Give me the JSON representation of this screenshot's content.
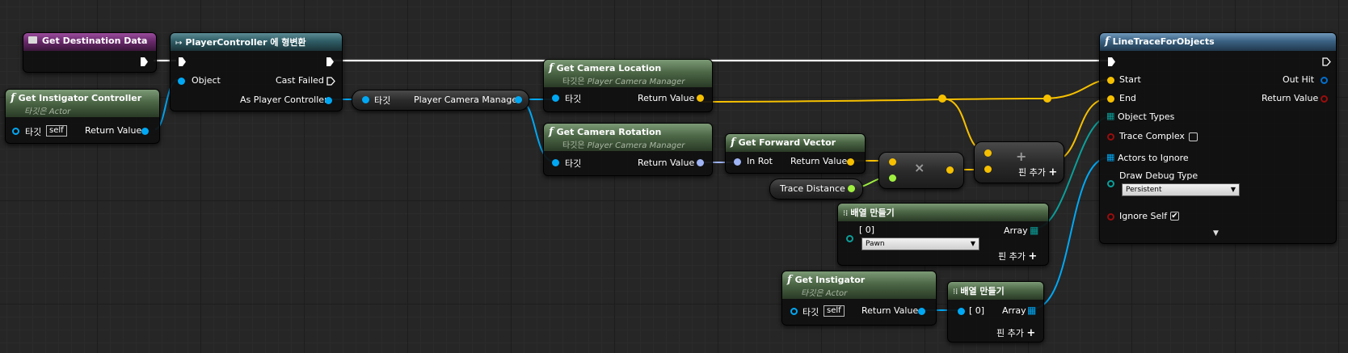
{
  "nodes": {
    "get_destination_data": {
      "title": "Get Destination Data",
      "icon": "struct-icon"
    },
    "get_instigator_controller": {
      "title": "Get Instigator Controller",
      "subtitle": "타깃은 Actor",
      "target_label": "타깃",
      "self_label": "self",
      "return_label": "Return Value"
    },
    "cast": {
      "title": "PlayerController 에 형변환",
      "object_label": "Object",
      "cast_failed_label": "Cast Failed",
      "as_label": "As Player Controller"
    },
    "player_camera_manager": {
      "target_label": "타깃",
      "output_label": "Player Camera Manager"
    },
    "get_camera_location": {
      "title": "Get Camera Location",
      "subtitle_prefix": "타깃은 ",
      "subtitle_class": "Player Camera Manager",
      "target_label": "타깃",
      "return_label": "Return Value"
    },
    "get_camera_rotation": {
      "title": "Get Camera Rotation",
      "subtitle_prefix": "타깃은 ",
      "subtitle_class": "Player Camera Manager",
      "target_label": "타깃",
      "return_label": "Return Value"
    },
    "get_forward_vector": {
      "title": "Get Forward Vector",
      "in_label": "In Rot",
      "return_label": "Return Value"
    },
    "multiply": {
      "symbol": "×"
    },
    "add": {
      "symbol": "+",
      "add_pin_label": "핀 추가"
    },
    "trace_distance": {
      "label": "Trace Distance"
    },
    "make_array_1": {
      "title": "배열 만들기",
      "index_label": "[ 0]",
      "array_label": "Array",
      "selected": "Pawn",
      "add_pin_label": "핀 추가"
    },
    "get_instigator": {
      "title": "Get Instigator",
      "subtitle": "타깃은 Actor",
      "target_label": "타깃",
      "self_label": "self",
      "return_label": "Return Value"
    },
    "make_array_2": {
      "title": "배열 만들기",
      "index_label": "[ 0]",
      "array_label": "Array",
      "add_pin_label": "핀 추가"
    },
    "line_trace": {
      "title": "LineTraceForObjects",
      "start_label": "Start",
      "end_label": "End",
      "object_types_label": "Object Types",
      "trace_complex_label": "Trace Complex",
      "actors_label": "Actors to Ignore",
      "draw_debug_label": "Draw Debug Type",
      "draw_debug_selected": "Persistent",
      "ignore_self_label": "Ignore Self",
      "ignore_self_checked": "✔",
      "out_hit_label": "Out Hit",
      "return_label": "Return Value"
    }
  },
  "colors": {
    "exec": "#ffffff",
    "object": "#00a8f4",
    "vector": "#f6c000",
    "rotator": "#9fb4f4",
    "float": "#a0f040",
    "struct": "#0b9f9a",
    "bool": "#9a0d0d",
    "out_hit": "#0070d0"
  }
}
